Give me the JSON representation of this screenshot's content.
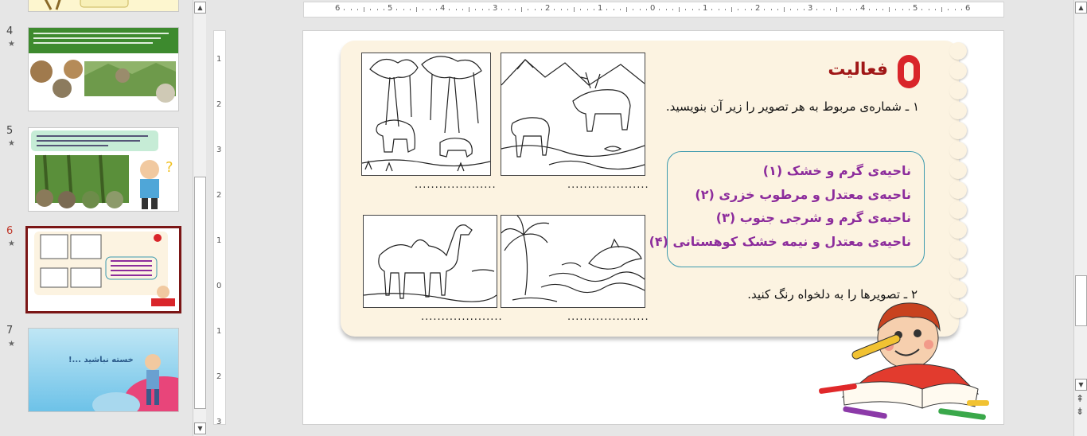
{
  "thumbnails": [
    {
      "number": "4",
      "star": "★"
    },
    {
      "number": "5",
      "star": "★"
    },
    {
      "number": "6",
      "star": "★"
    },
    {
      "number": "7",
      "star": "★",
      "text": "خسته نباشید ...!"
    }
  ],
  "ruler": {
    "h_labels": [
      "6",
      "5",
      "4",
      "3",
      "2",
      "1",
      "0",
      "1",
      "2",
      "3",
      "4",
      "5",
      "6"
    ],
    "v_labels": [
      "1",
      "2",
      "3",
      "2",
      "1",
      "0",
      "1",
      "2",
      "3"
    ]
  },
  "slide": {
    "title": "فعالیت",
    "q1": "۱ ـ شماره‌ی مربوط به هر تصویر را زیر آن بنویسید.",
    "legend": [
      "ناحیه‌ی گرم و خشک (۱)",
      "ناحیه‌ی معتدل و مرطوب خزری (۲)",
      "ناحیه‌ی گرم و شرجی جنوب (۳)",
      "ناحیه‌ی معتدل و نیمه خشک کوهستانی (۴)"
    ],
    "q2": "۲ ـ تصویرها را به دلخواه رنگ کنید.",
    "blank": "...................."
  },
  "colors": {
    "accent_red": "#d9252a",
    "title_red": "#a01717",
    "legend_purple": "#8c2c9c",
    "legend_border": "#3c9aae",
    "panel_bg": "#fcf3e1",
    "selected_border": "#7b1616"
  },
  "icons": {
    "panel_scroll_up": "▲",
    "panel_scroll_down": "▼",
    "editor_scroll_up": "▲",
    "editor_scroll_down": "▼",
    "prev_slide": "⇞",
    "next_slide": "⇟"
  }
}
